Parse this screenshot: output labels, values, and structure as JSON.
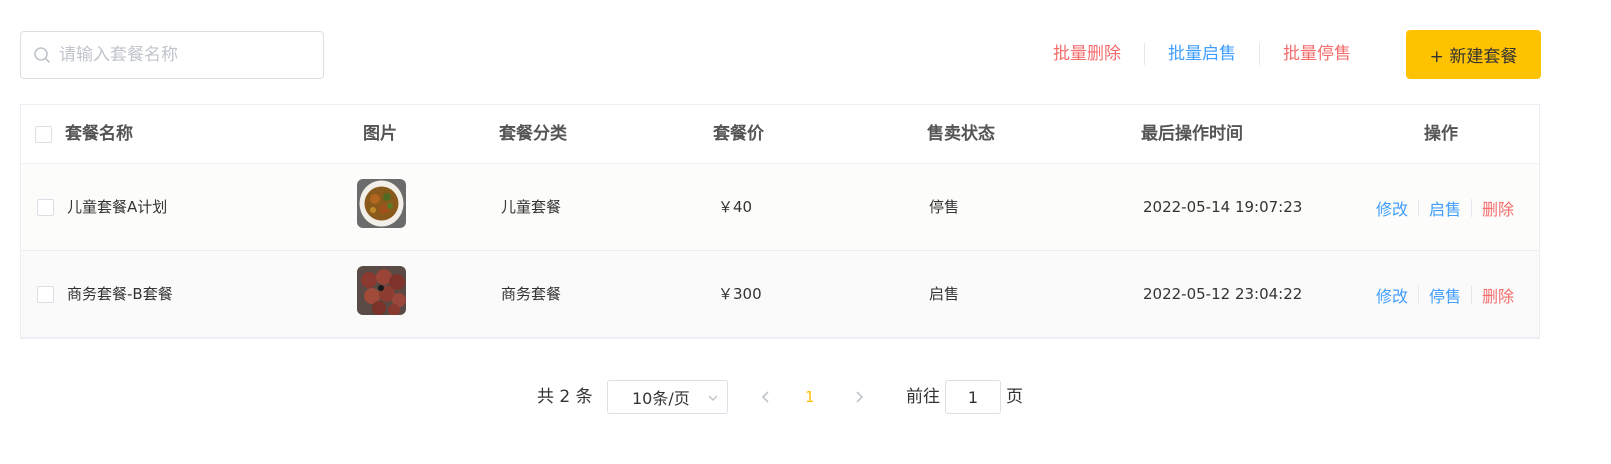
{
  "toolbar": {
    "search_placeholder": "请输入套餐名称",
    "search_value": "",
    "batch_delete": "批量删除",
    "batch_enable": "批量启售",
    "batch_disable": "批量停售",
    "add_button": "+ 新建套餐"
  },
  "table": {
    "columns": [
      "套餐名称",
      "图片",
      "套餐分类",
      "套餐价",
      "售卖状态",
      "最后操作时间",
      "操作"
    ],
    "rows": [
      {
        "name": "儿童套餐A计划",
        "category": "儿童套餐",
        "price": "￥40",
        "status": "停售",
        "updated": "2022-05-14 19:07:23",
        "ops": [
          "修改",
          "启售",
          "删除"
        ]
      },
      {
        "name": "商务套餐-B套餐",
        "category": "商务套餐",
        "price": "￥300",
        "status": "启售",
        "updated": "2022-05-12 23:04:22",
        "ops": [
          "修改",
          "停售",
          "删除"
        ]
      }
    ]
  },
  "pagination": {
    "total": "共 2 条",
    "page_size": "10条/页",
    "current_page": "1",
    "goto_label": "前往",
    "goto_value": "1",
    "page_suffix": "页"
  },
  "colors": {
    "accent": "#ffc200",
    "danger": "#f56c6c",
    "link": "#409eff"
  },
  "icons": {
    "search": "search-icon",
    "dropdown": "chevron-down-icon",
    "prev": "chevron-left-icon",
    "next": "chevron-right-icon"
  }
}
